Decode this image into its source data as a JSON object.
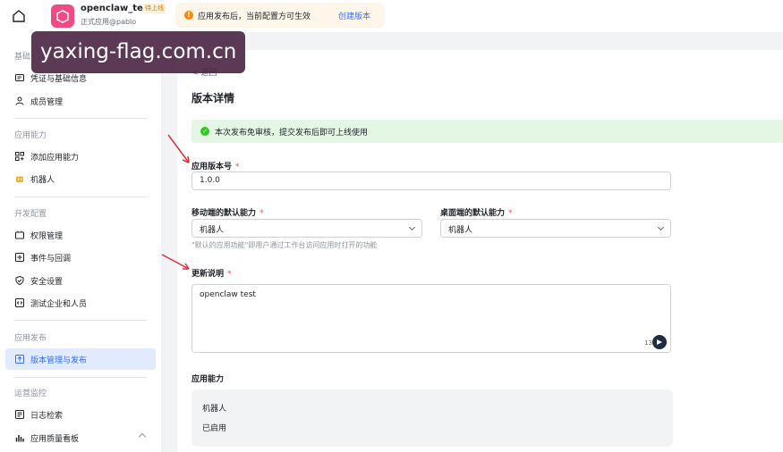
{
  "header": {
    "app_name": "openclaw_test",
    "app_status": "待上线",
    "app_subtitle": "正式应用@pablo",
    "notice_text": "应用发布后，当前配置方可生效",
    "notice_link": "创建版本"
  },
  "sidebar": {
    "sections": [
      {
        "title": "基础"
      },
      {
        "title": "应用能力"
      },
      {
        "title": "开发配置"
      },
      {
        "title": "应用发布"
      },
      {
        "title": "运营监控"
      }
    ],
    "items": [
      {
        "label": "凭证与基础信息",
        "icon": "id-card-icon"
      },
      {
        "label": "成员管理",
        "icon": "user-icon"
      },
      {
        "label": "添加应用能力",
        "icon": "grid-icon"
      },
      {
        "label": "机器人",
        "icon": "robot-icon"
      },
      {
        "label": "权限管理",
        "icon": "key-icon"
      },
      {
        "label": "事件与回调",
        "icon": "event-icon"
      },
      {
        "label": "安全设置",
        "icon": "shield-icon"
      },
      {
        "label": "测试企业和人员",
        "icon": "code-icon"
      },
      {
        "label": "版本管理与发布",
        "icon": "upload-icon",
        "active": true
      },
      {
        "label": "日志检索",
        "icon": "log-icon"
      },
      {
        "label": "应用质量看板",
        "icon": "chart-icon"
      }
    ]
  },
  "main": {
    "back_label": "< 返回",
    "title": "版本详情",
    "success_banner": "本次发布免审核，提交发布后即可上线使用",
    "version_label": "应用版本号",
    "version_value": "1.0.0",
    "mobile_label": "移动端的默认能力",
    "mobile_value": "机器人",
    "desktop_label": "桌面端的默认能力",
    "desktop_value": "机器人",
    "ability_hint": "\"默认的应用功能\"即用户通过工作台访问应用时打开的功能",
    "notes_label": "更新说明",
    "notes_value": "openclaw test",
    "char_count": "13",
    "capability_title": "应用能力",
    "capability_name": "机器人",
    "capability_status": "已启用",
    "required_mark": "*"
  },
  "watermark": "yaxing-flag.com.cn",
  "colors": {
    "accent": "#3370ff",
    "success_bg": "#e4f6e4",
    "warning": "#ff8800",
    "required": "#f54a45"
  }
}
